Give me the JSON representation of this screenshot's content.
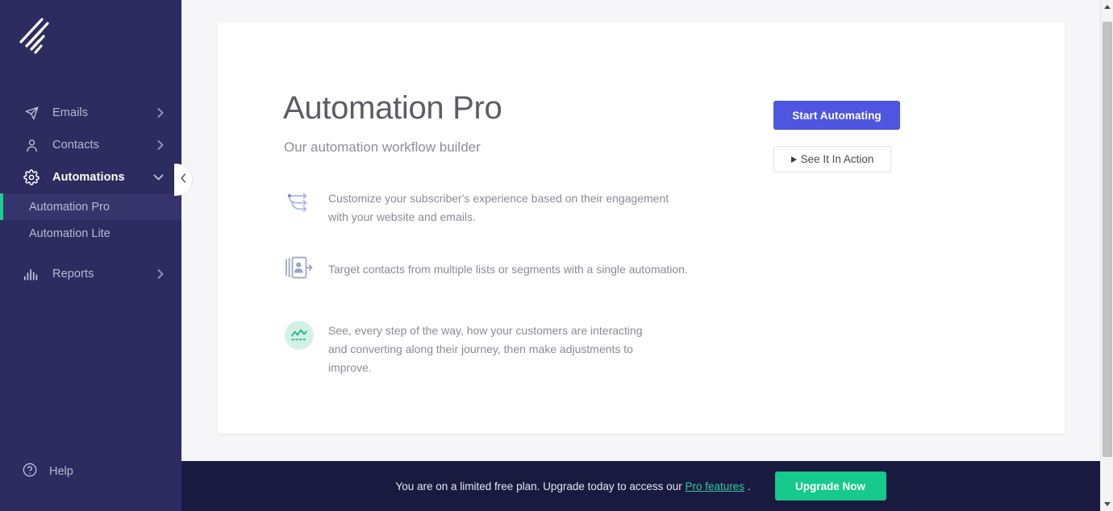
{
  "brand": {
    "logo_name": "benchmark-logo",
    "sidebar_bg": "#2c2c60",
    "banner_bg": "#191a3f",
    "accent_green": "#1fce8f",
    "accent_blue": "#4e55e0"
  },
  "sidebar": {
    "items": [
      {
        "label": "Emails",
        "icon": "paper-plane-icon",
        "chevron": "chevron-right",
        "active": false
      },
      {
        "label": "Contacts",
        "icon": "person-icon",
        "chevron": "chevron-right",
        "active": false
      },
      {
        "label": "Automations",
        "icon": "gear-icon",
        "chevron": "chevron-down",
        "active": true
      }
    ],
    "sub_items": [
      {
        "label": "Automation Pro",
        "selected": true
      },
      {
        "label": "Automation Lite",
        "selected": false
      }
    ],
    "reports": {
      "label": "Reports",
      "icon": "bar-chart-icon",
      "chevron": "chevron-right"
    },
    "help": {
      "label": "Help",
      "icon": "question-circle-icon"
    },
    "collapse_handle": {
      "icon": "chevron-left-icon"
    }
  },
  "main": {
    "title": "Automation Pro",
    "subtitle": "Our automation workflow builder",
    "primary_cta": "Start Automating",
    "secondary_cta": "See It In Action",
    "features": [
      {
        "icon": "branch-arrows-icon",
        "text": "Customize your subscriber's experience based on their engagement with your website and emails."
      },
      {
        "icon": "contact-import-icon",
        "text": "Target contacts from multiple lists or segments with a single automation."
      },
      {
        "icon": "trend-chart-circle-icon",
        "text": "See, every step of the way, how your customers are interacting and converting along their journey, then make adjustments to improve."
      }
    ]
  },
  "banner": {
    "text_before": "You are on a limited free plan. Upgrade today to access our ",
    "link_text": "Pro features",
    "text_after": " .",
    "button_label": "Upgrade Now"
  },
  "scrollbar": {
    "up_arrow": "scroll-up-arrow",
    "down_arrow": "scroll-down-arrow"
  }
}
